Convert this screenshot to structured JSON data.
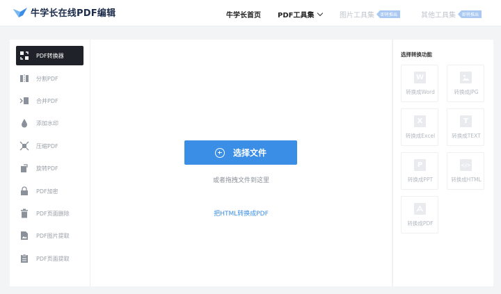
{
  "header": {
    "logo_text": "牛学长在线PDF编辑",
    "nav": {
      "home": "牛学长首页",
      "pdf_tools": "PDF工具集",
      "image_tools": "图片工具集",
      "other_tools": "其他工具集",
      "coming_soon": "即将推出"
    }
  },
  "sidebar": {
    "items": [
      {
        "label": "PDF转换器",
        "icon": "convert-icon",
        "active": true
      },
      {
        "label": "分割PDF",
        "icon": "split-icon"
      },
      {
        "label": "合并PDF",
        "icon": "merge-icon"
      },
      {
        "label": "添加水印",
        "icon": "watermark-icon"
      },
      {
        "label": "压缩PDF",
        "icon": "compress-icon"
      },
      {
        "label": "旋转PDF",
        "icon": "rotate-icon"
      },
      {
        "label": "PDF加密",
        "icon": "lock-icon"
      },
      {
        "label": "PDF页面删除",
        "icon": "trash-icon"
      },
      {
        "label": "PDF图片提取",
        "icon": "image-extract-icon"
      },
      {
        "label": "PDF页面提取",
        "icon": "page-extract-icon"
      }
    ]
  },
  "main": {
    "select_button": "选择文件",
    "drag_hint": "或者拖拽文件到这里",
    "html_link": "把HTML转换成PDF"
  },
  "right_panel": {
    "title": "选择转换功能",
    "tools": [
      {
        "label": "转换成Word",
        "glyph": "W"
      },
      {
        "label": "转换成JPG",
        "glyph": ""
      },
      {
        "label": "转换成Excel",
        "glyph": "X"
      },
      {
        "label": "转换成TEXT",
        "glyph": "T"
      },
      {
        "label": "转换成PPT",
        "glyph": "P"
      },
      {
        "label": "转换成HTML",
        "glyph": "</>"
      },
      {
        "label": "转换成PDF",
        "glyph": ""
      }
    ]
  },
  "colors": {
    "accent": "#3a8ee6",
    "sidebar_active": "#1f2229",
    "muted": "#9aa0a8"
  }
}
